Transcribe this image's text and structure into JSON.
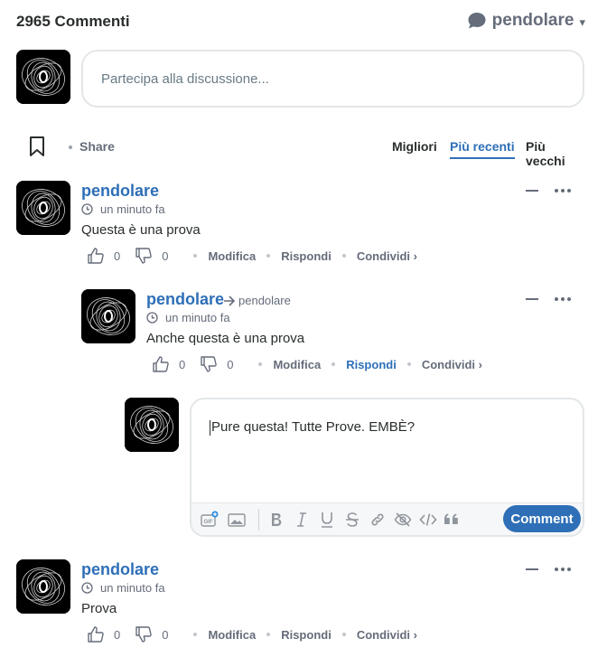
{
  "header": {
    "comment_count": "2965 Commenti",
    "username": "pendolare",
    "caret": "▾"
  },
  "new_comment": {
    "placeholder": "Partecipa alla discussione..."
  },
  "sortbar": {
    "share_label": "Share",
    "tabs": [
      "Migliori",
      "Più recenti",
      "Più vecchi"
    ],
    "active_tab": "Più recenti"
  },
  "comments": [
    {
      "author": "pendolare",
      "time": "un minuto fa",
      "text": "Questa è una prova",
      "likes": "0",
      "dislikes": "0",
      "actions": [
        "Modifica",
        "Rispondi",
        "Condividi ›"
      ]
    },
    {
      "author": "pendolare",
      "reply_to": "pendolare",
      "time": "un minuto fa",
      "text": "Anche questa è una prova",
      "likes": "0",
      "dislikes": "0",
      "actions": [
        "Modifica",
        "Rispondi",
        "Condividi ›"
      ],
      "active_action": "Rispondi"
    },
    {
      "author": "pendolare",
      "time": "un minuto fa",
      "text": "Prova",
      "likes": "0",
      "dislikes": "0",
      "actions": [
        "Modifica",
        "Rispondi",
        "Condividi ›"
      ]
    }
  ],
  "reply_editor": {
    "value": "Pure questa! Tutte Prove. EMBÈ?",
    "submit_label": "Comment",
    "tools": [
      "gif-icon",
      "image-icon",
      "bold-icon",
      "italic-icon",
      "underline-icon",
      "strikethrough-icon",
      "link-icon",
      "spoiler-icon",
      "code-icon",
      "quote-icon"
    ]
  },
  "colors": {
    "accent": "#2e6fb7",
    "muted": "#656c7a",
    "text": "#2a2e2e",
    "border": "#e3e6e8"
  }
}
